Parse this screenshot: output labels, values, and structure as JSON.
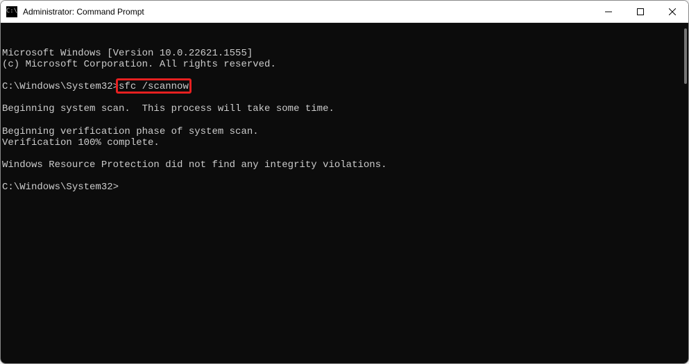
{
  "titlebar": {
    "title": "Administrator: Command Prompt"
  },
  "terminal": {
    "lines": [
      "Microsoft Windows [Version 10.0.22621.1555]",
      "(c) Microsoft Corporation. All rights reserved.",
      "",
      "C:\\Windows\\System32>sfc /scannow",
      "",
      "Beginning system scan.  This process will take some time.",
      "",
      "Beginning verification phase of system scan.",
      "Verification 100% complete.",
      "",
      "Windows Resource Protection did not find any integrity violations.",
      "",
      "C:\\Windows\\System32>"
    ],
    "highlighted_command": "sfc /scannow",
    "highlight_line_index": 3,
    "prompt_text": "C:\\Windows\\System32>"
  }
}
